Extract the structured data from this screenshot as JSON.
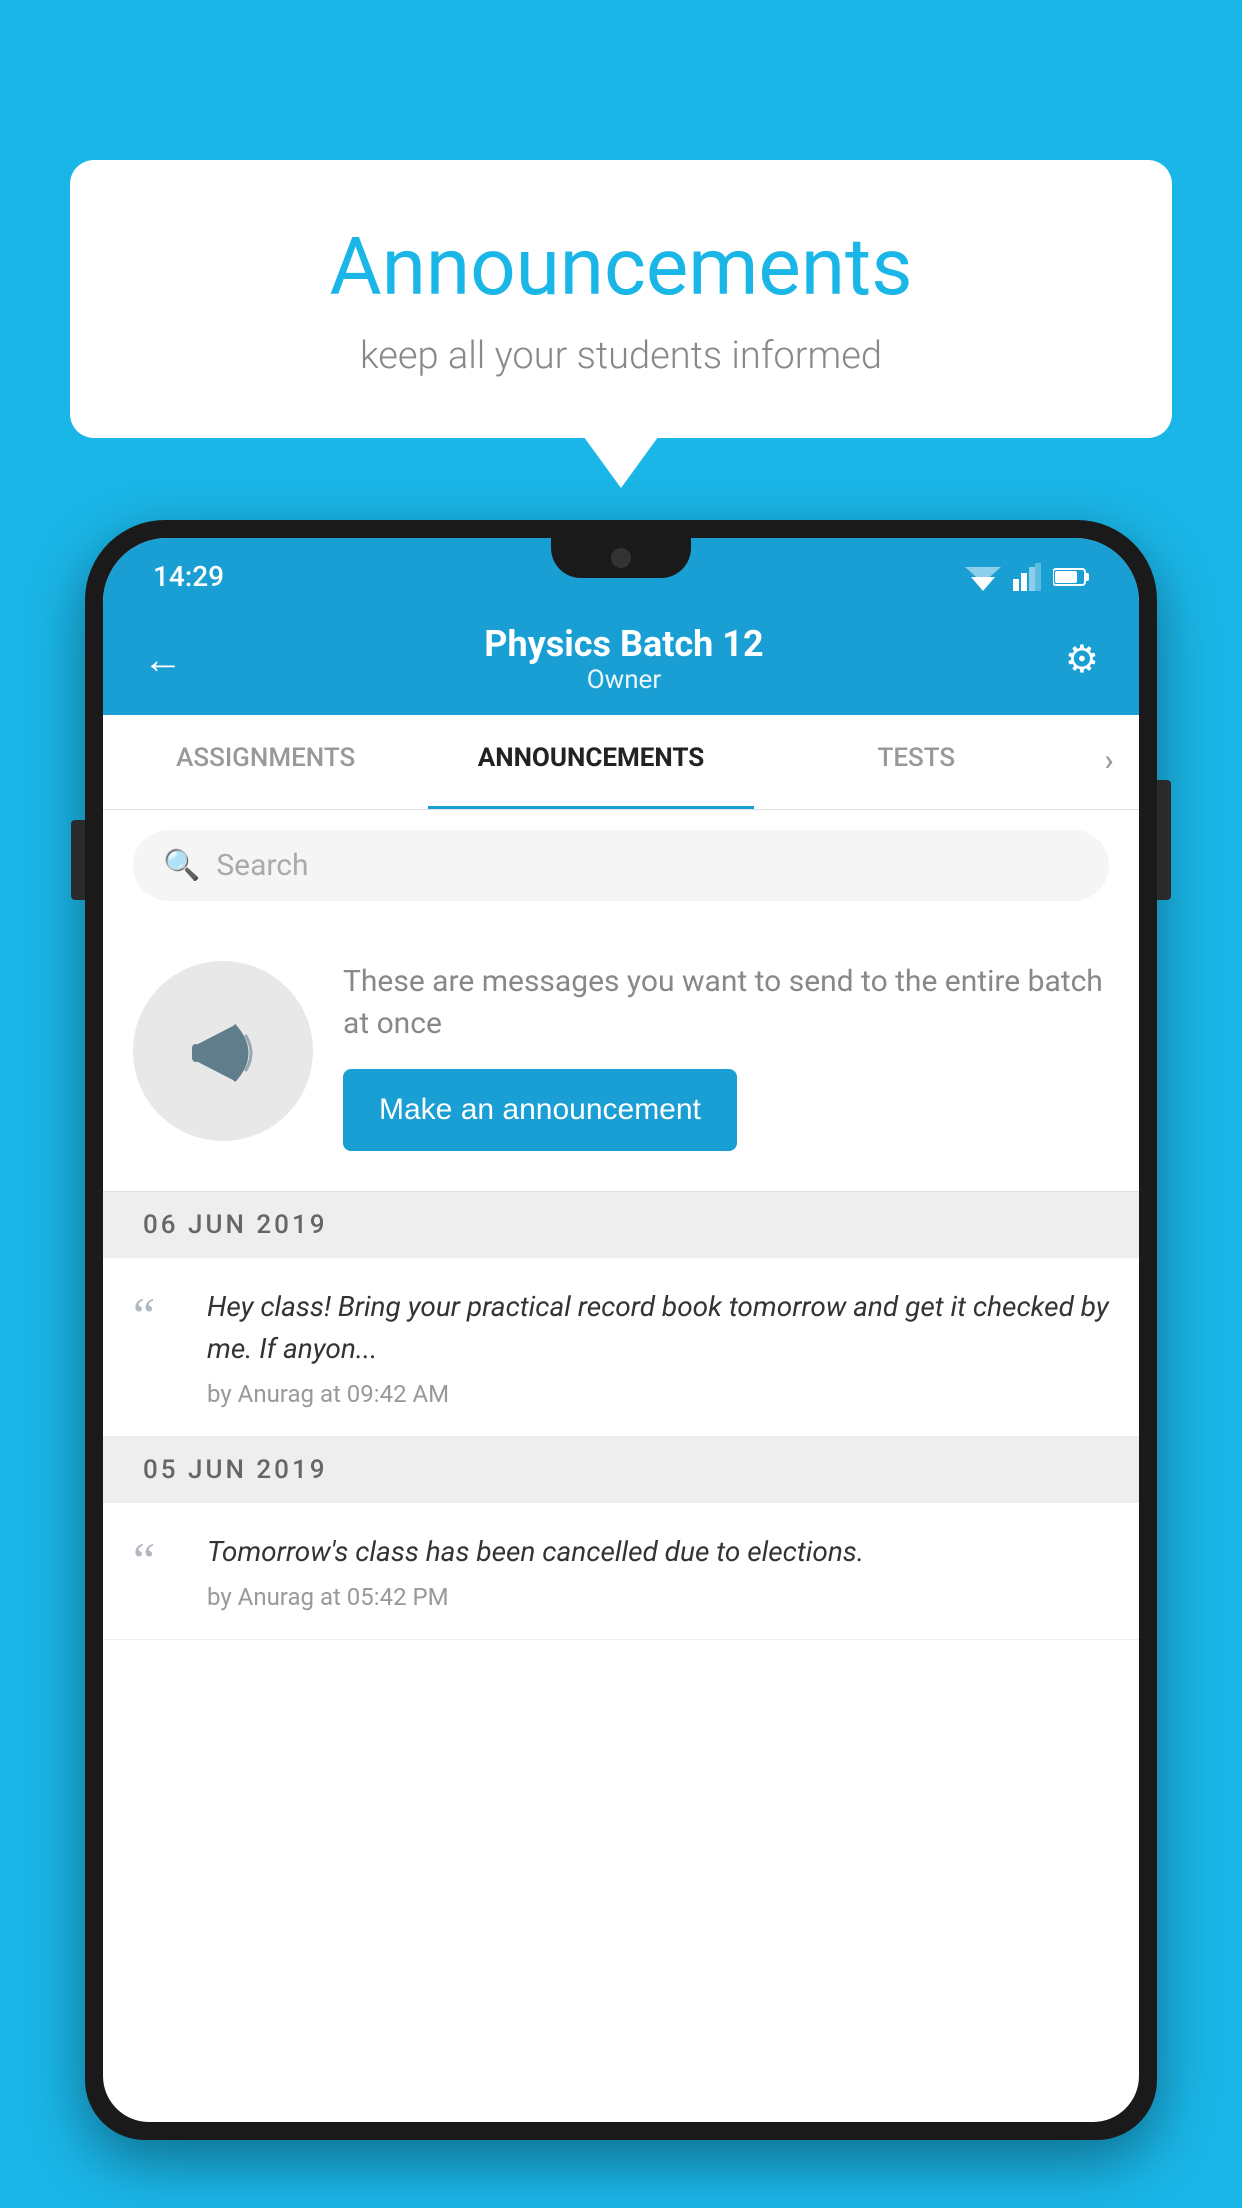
{
  "background_color": "#1ab6e8",
  "speech_bubble": {
    "title": "Announcements",
    "subtitle": "keep all your students informed"
  },
  "phone": {
    "status_bar": {
      "time": "14:29"
    },
    "header": {
      "title": "Physics Batch 12",
      "subtitle": "Owner",
      "back_label": "←",
      "settings_label": "⚙"
    },
    "tabs": [
      {
        "label": "ASSIGNMENTS",
        "active": false
      },
      {
        "label": "ANNOUNCEMENTS",
        "active": true
      },
      {
        "label": "TESTS",
        "active": false
      },
      {
        "label": "›",
        "active": false
      }
    ],
    "search": {
      "placeholder": "Search"
    },
    "promo": {
      "description": "These are messages you want to send to the entire batch at once",
      "button_label": "Make an announcement"
    },
    "announcements": [
      {
        "date": "06  JUN  2019",
        "text": "Hey class! Bring your practical record book tomorrow and get it checked by me. If anyon...",
        "meta": "by Anurag at 09:42 AM"
      },
      {
        "date": "05  JUN  2019",
        "text": "Tomorrow's class has been cancelled due to elections.",
        "meta": "by Anurag at 05:42 PM"
      }
    ]
  }
}
